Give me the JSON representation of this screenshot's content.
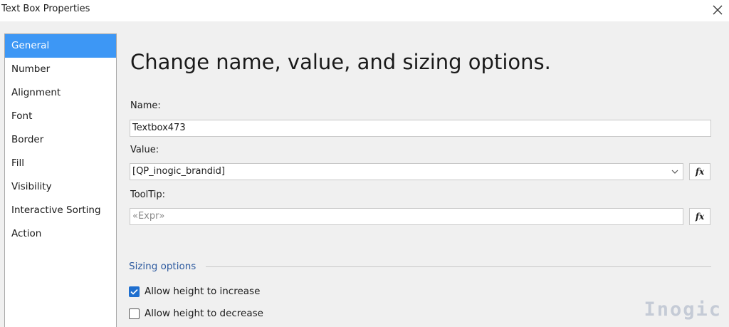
{
  "window": {
    "title": "Text Box Properties",
    "close_icon": "close-icon"
  },
  "sidebar": {
    "items": [
      {
        "label": "General",
        "selected": true
      },
      {
        "label": "Number",
        "selected": false
      },
      {
        "label": "Alignment",
        "selected": false
      },
      {
        "label": "Font",
        "selected": false
      },
      {
        "label": "Border",
        "selected": false
      },
      {
        "label": "Fill",
        "selected": false
      },
      {
        "label": "Visibility",
        "selected": false
      },
      {
        "label": "Interactive Sorting",
        "selected": false
      },
      {
        "label": "Action",
        "selected": false
      }
    ]
  },
  "main": {
    "heading": "Change name, value, and sizing options.",
    "name": {
      "label": "Name:",
      "value": "Textbox473"
    },
    "value": {
      "label": "Value:",
      "value": "[QP_inogic_brandid]",
      "fx_label": "fx"
    },
    "tooltip": {
      "label": "ToolTip:",
      "placeholder": "«Expr»",
      "fx_label": "fx"
    },
    "sizing": {
      "title": "Sizing options",
      "allow_increase": {
        "label": "Allow height to increase",
        "checked": true
      },
      "allow_decrease": {
        "label": "Allow height to decrease",
        "checked": false
      }
    }
  },
  "watermark": {
    "text": "Inogic"
  },
  "colors": {
    "selection": "#3d97f5",
    "section_title": "#2d5a9f",
    "checkbox_checked": "#1f6fcf"
  }
}
